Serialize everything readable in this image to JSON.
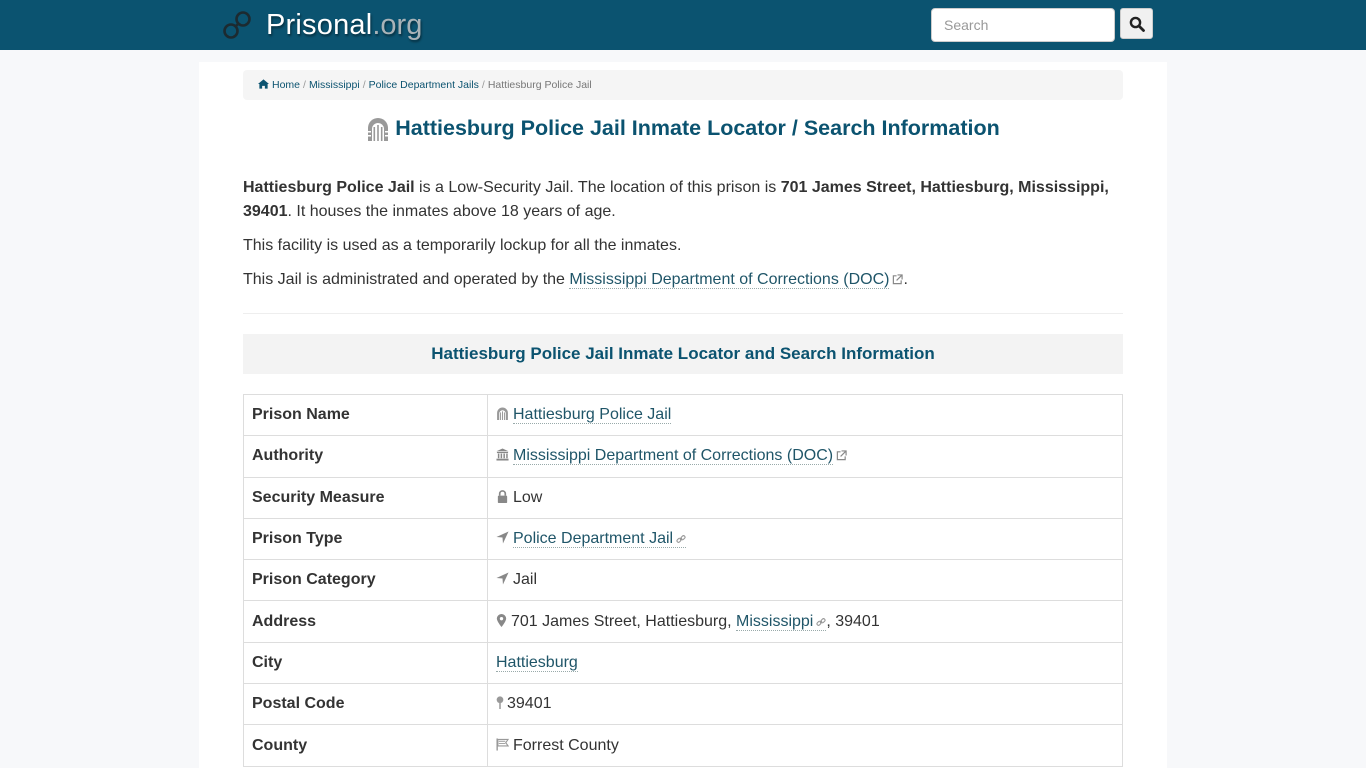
{
  "header": {
    "brand_name": "Prisonal",
    "brand_tld": ".org",
    "search_placeholder": "Search",
    "search_value": ""
  },
  "breadcrumb": {
    "items": [
      "Home",
      "Mississippi",
      "Police Department Jails"
    ],
    "active": "Hattiesburg Police Jail",
    "separator": "/"
  },
  "page": {
    "title": "Hattiesburg Police Jail Inmate Locator / Search Information",
    "intro": {
      "p1_name": "Hattiesburg Police Jail",
      "p1_text_a": " is a Low-Security Jail. The location of this prison is ",
      "p1_address": "701 James Street, Hattiesburg, Mississippi, 39401",
      "p1_text_b": ". It houses the inmates above 18 years of age.",
      "p2": "This facility is used as a temporarily lockup for all the inmates.",
      "p3_text": "This Jail is administrated and operated by the ",
      "p3_link": "Mississippi Department of Corrections (DOC)",
      "p3_end": "."
    },
    "section_heading": "Hattiesburg Police Jail Inmate Locator and Search Information"
  },
  "info_table": {
    "rows": [
      {
        "label": "Prison Name",
        "value": "Hattiesburg Police Jail",
        "icon": "prison-gate-icon"
      },
      {
        "label": "Authority",
        "value": "Mississippi Department of Corrections (DOC)",
        "icon": "institution-icon"
      },
      {
        "label": "Security Measure",
        "value": "Low",
        "icon": "lock-icon"
      },
      {
        "label": "Prison Type",
        "value": "Police Department Jail",
        "icon": "location-arrow-icon"
      },
      {
        "label": "Prison Category",
        "value": "Jail",
        "icon": "location-arrow-icon"
      },
      {
        "label": "Address",
        "street": "701 James Street, Hattiesburg, ",
        "state": "Mississippi",
        "zip": ", 39401",
        "icon": "map-marker-icon"
      },
      {
        "label": "City",
        "value": "Hattiesburg"
      },
      {
        "label": "Postal Code",
        "value": "39401",
        "icon": "map-pin-icon"
      },
      {
        "label": "County",
        "value": "Forrest County",
        "icon": "flag-icon"
      }
    ]
  },
  "colors": {
    "navbar": "#0b5370",
    "heading": "#0b5370",
    "link": "#1f5568",
    "icon_gray": "#888888"
  }
}
